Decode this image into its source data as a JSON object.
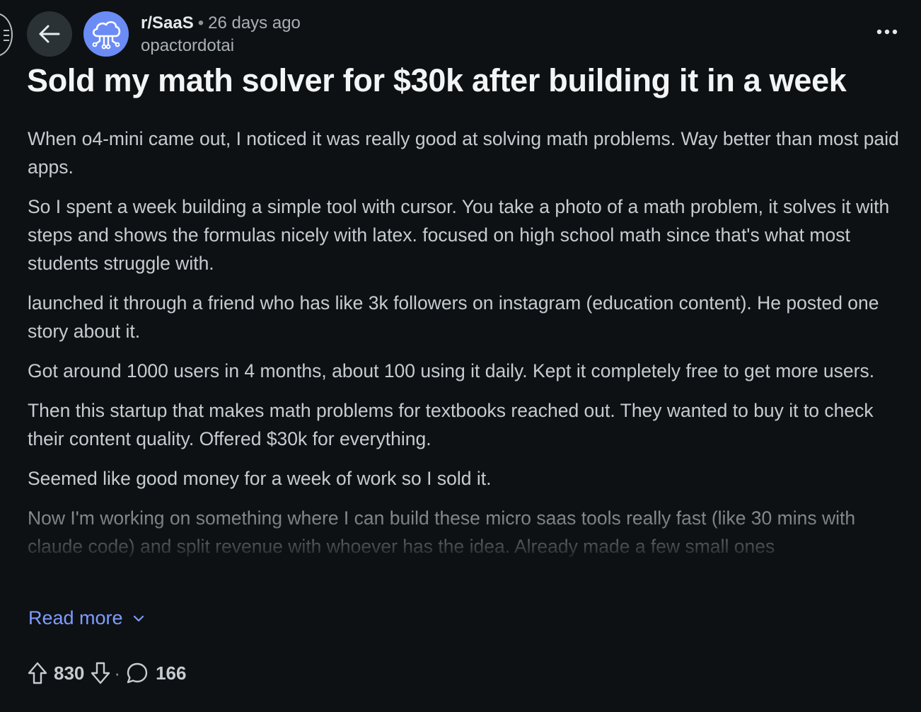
{
  "header": {
    "subreddit": "r/SaaS",
    "separator": "•",
    "time_ago": "26 days ago",
    "username": "opactordotai"
  },
  "icons": {
    "back": "back-arrow-icon",
    "avatar": "cloud-circuit-icon",
    "more": "more-dots-icon",
    "upvote": "upvote-arrow-icon",
    "downvote": "downvote-arrow-icon",
    "comment": "comment-bubble-icon",
    "read_more": "chevron-down-icon"
  },
  "colors": {
    "background": "#0e1113",
    "avatar": "#6b8cf5",
    "link": "#7f9cff"
  },
  "post": {
    "title": "Sold my math solver for $30k after building it in a week",
    "paragraphs": [
      "When o4-mini came out, I noticed it was really good at solving math problems. Way better than most paid apps.",
      "So I spent a week building a simple tool with cursor. You take a photo of a math problem, it solves it with steps and shows the formulas nicely with latex. focused on high school math since that's what most students struggle with.",
      "launched it through a friend who has like 3k followers on instagram (education content). He posted one story about it.",
      "Got around 1000 users in 4 months, about 100 using it daily. Kept it completely free to get more users.",
      "Then this startup that makes math problems for textbooks reached out. They wanted to buy it to check their content quality. Offered $30k for everything.",
      "Seemed like good money for a week of work so I sold it."
    ],
    "truncated_paragraph": "Now I'm working on something where I can build these micro saas tools really fast (like 30 mins with claude code) and split revenue with whoever has the idea. Already made a few small ones"
  },
  "read_more_label": "Read more",
  "footer": {
    "upvotes": "830",
    "separator": "·",
    "comments": "166"
  }
}
